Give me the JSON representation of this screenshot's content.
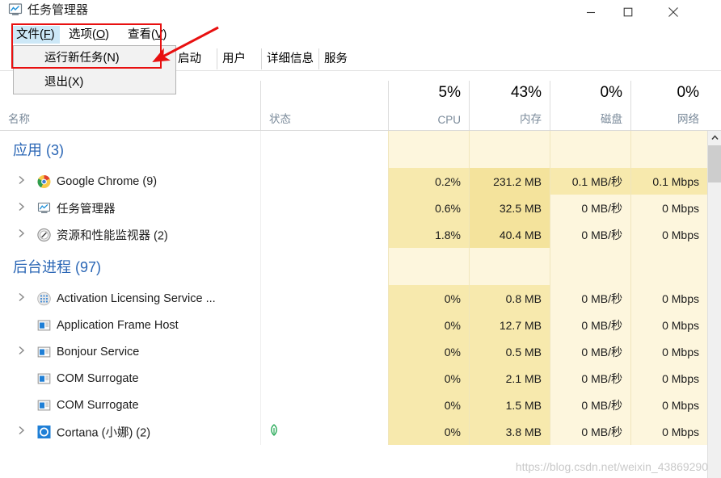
{
  "window": {
    "title": "任务管理器",
    "icon": "task-manager-icon",
    "minimize_label": "最小化",
    "maximize_label": "最大化",
    "close_label": "关闭"
  },
  "menubar": {
    "items": [
      {
        "label": "文件(F)",
        "main": "文件(",
        "accel": "F",
        "tail": ")",
        "active": true
      },
      {
        "label": "选项(O)",
        "main": "选项(",
        "accel": "O",
        "tail": ")",
        "active": false
      },
      {
        "label": "查看(V)",
        "main": "查看(",
        "accel": "V",
        "tail": ")",
        "active": false
      }
    ]
  },
  "file_menu": {
    "open": true,
    "items": [
      {
        "label": "运行新任务(N)"
      },
      {
        "label": "退出(X)"
      }
    ]
  },
  "tabs": [
    {
      "label": "启动",
      "selected": false
    },
    {
      "label": "用户",
      "selected": false
    },
    {
      "label": "详细信息",
      "selected": false
    },
    {
      "label": "服务",
      "selected": false
    }
  ],
  "columns": [
    {
      "key": "name",
      "label": "名称",
      "value": "",
      "align": "left"
    },
    {
      "key": "status",
      "label": "状态",
      "value": "",
      "align": "left"
    },
    {
      "key": "cpu",
      "label": "CPU",
      "value": "5%",
      "align": "right"
    },
    {
      "key": "memory",
      "label": "内存",
      "value": "43%",
      "align": "right"
    },
    {
      "key": "disk",
      "label": "磁盘",
      "value": "0%",
      "align": "right"
    },
    {
      "key": "network",
      "label": "网络",
      "value": "0%",
      "align": "right"
    }
  ],
  "sections": [
    {
      "id": "apps",
      "title": "应用 (3)",
      "rows": [
        {
          "name": "Google Chrome (9)",
          "icon": "chrome-icon",
          "expandable": true,
          "status": "",
          "cpu": "0.2%",
          "memory": "231.2 MB",
          "disk": "0.1 MB/秒",
          "network": "0.1 Mbps"
        },
        {
          "name": "任务管理器",
          "icon": "task-manager-icon",
          "expandable": true,
          "status": "",
          "cpu": "0.6%",
          "memory": "32.5 MB",
          "disk": "0 MB/秒",
          "network": "0 Mbps"
        },
        {
          "name": "资源和性能监视器 (2)",
          "icon": "resource-monitor-icon",
          "expandable": true,
          "status": "",
          "cpu": "1.8%",
          "memory": "40.4 MB",
          "disk": "0 MB/秒",
          "network": "0 Mbps"
        }
      ]
    },
    {
      "id": "background",
      "title": "后台进程 (97)",
      "rows": [
        {
          "name": "Activation Licensing Service ...",
          "icon": "grid-app-icon",
          "expandable": true,
          "status": "",
          "cpu": "0%",
          "memory": "0.8 MB",
          "disk": "0 MB/秒",
          "network": "0 Mbps"
        },
        {
          "name": "Application Frame Host",
          "icon": "window-app-icon",
          "expandable": false,
          "status": "",
          "cpu": "0%",
          "memory": "12.7 MB",
          "disk": "0 MB/秒",
          "network": "0 Mbps"
        },
        {
          "name": "Bonjour Service",
          "icon": "window-app-icon",
          "expandable": true,
          "status": "",
          "cpu": "0%",
          "memory": "0.5 MB",
          "disk": "0 MB/秒",
          "network": "0 Mbps"
        },
        {
          "name": "COM Surrogate",
          "icon": "window-app-icon",
          "expandable": false,
          "status": "",
          "cpu": "0%",
          "memory": "2.1 MB",
          "disk": "0 MB/秒",
          "network": "0 Mbps"
        },
        {
          "name": "COM Surrogate",
          "icon": "window-app-icon",
          "expandable": false,
          "status": "",
          "cpu": "0%",
          "memory": "1.5 MB",
          "disk": "0 MB/秒",
          "network": "0 Mbps"
        },
        {
          "name": "Cortana (小娜) (2)",
          "icon": "cortana-icon",
          "expandable": true,
          "status": "suspended-leaf",
          "cpu": "0%",
          "memory": "3.8 MB",
          "disk": "0 MB/秒",
          "network": "0 Mbps"
        }
      ]
    }
  ],
  "scrollbar": {
    "up_arrow": "chevron-up-icon"
  },
  "annotations": {
    "highlight_box_color": "#e81010",
    "arrow_color": "#e81010"
  },
  "watermark": {
    "text": "https://blog.csdn.net/weixin_43869290"
  },
  "colors": {
    "section_band": "#fdf6dd",
    "heat_light": "#fdf6dd",
    "heat_mid": "#f7e9ad",
    "heat_strong": "#f4e39c",
    "section_title": "#2a66b5",
    "header_label": "#7a8a9a",
    "menu_highlight": "#cde8f7"
  }
}
